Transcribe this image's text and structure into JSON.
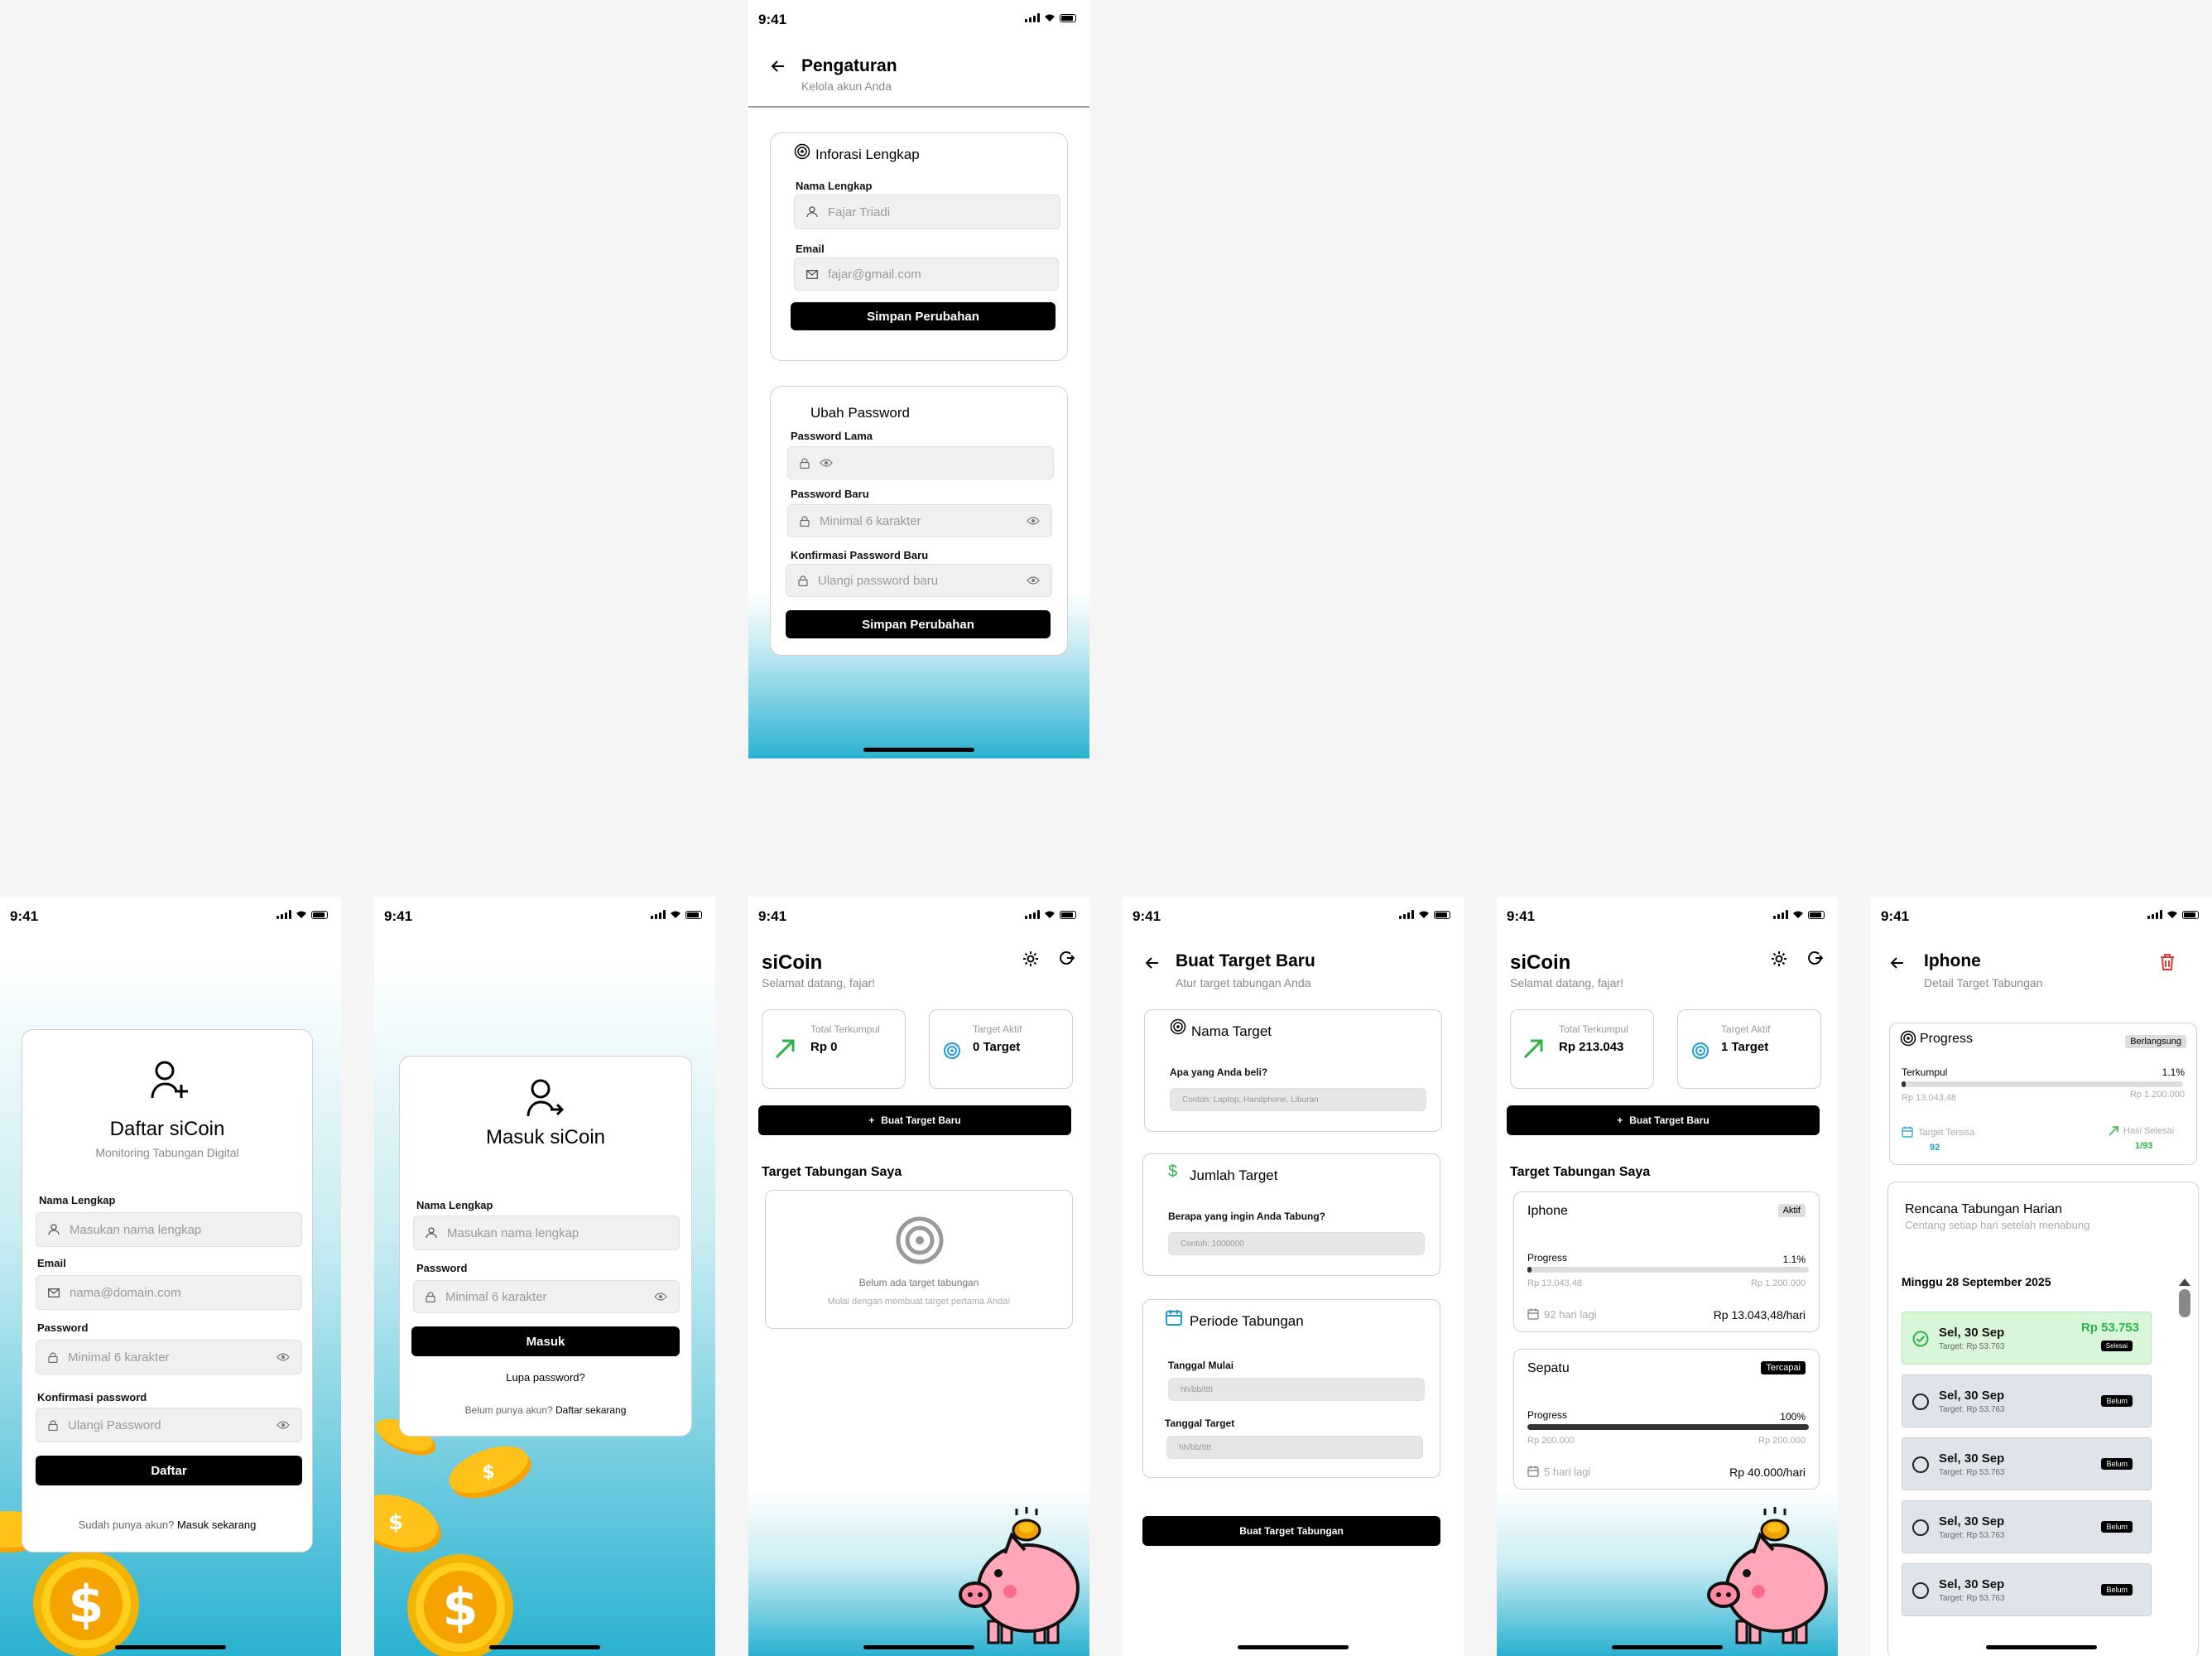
{
  "status_time": "9:41",
  "settings": {
    "title": "Pengaturan",
    "subtitle": "Kelola akun Anda",
    "info_title": "Inforasi Lengkap",
    "name_label": "Nama Lengkap",
    "name_value": "Fajar Triadi",
    "email_label": "Email",
    "email_value": "fajar@gmail.com",
    "save_label": "Simpan Perubahan",
    "pw_title": "Ubah Password",
    "old_pw_label": "Password Lama",
    "new_pw_label": "Password Baru",
    "new_pw_placeholder": "Minimal 6 karakter",
    "confirm_label": "Konfirmasi Password Baru",
    "confirm_placeholder": "Ulangi password baru",
    "save2_label": "Simpan Perubahan"
  },
  "register": {
    "title": "Daftar siCoin",
    "subtitle": "Monitoring Tabungan Digital",
    "name_label": "Nama Lengkap",
    "name_placeholder": "Masukan nama lengkap",
    "email_label": "Email",
    "email_placeholder": "nama@domain.com",
    "password_label": "Password",
    "password_placeholder": "Minimal 6 karakter",
    "confirm_label": "Konfirmasi password",
    "confirm_placeholder": "Ulangi Password",
    "submit_label": "Daftar",
    "footer_text": "Sudah punya akun?",
    "footer_link": "Masuk sekarang"
  },
  "login": {
    "title": "Masuk siCoin",
    "name_label": "Nama Lengkap",
    "name_placeholder": "Masukan nama lengkap",
    "password_label": "Password",
    "password_placeholder": "Minimal 6 karakter",
    "submit_label": "Masuk",
    "forgot_label": "Lupa password?",
    "footer_text": "Belum punya akun?",
    "footer_link": "Daftar sekarang"
  },
  "dashboard_empty": {
    "brand": "siCoin",
    "greeting": "Selamat datang, fajar!",
    "total_label": "Total Terkumpul",
    "total_value": "Rp 0",
    "active_label": "Target Aktif",
    "active_value": "0 Target",
    "new_target_label": "Buat Target Baru",
    "section_title": "Target Tabungan Saya",
    "empty_title": "Belum ada target tabungan",
    "empty_sub": "Mulai dengan membuat target pertama Anda!"
  },
  "new_target": {
    "title": "Buat Target Baru",
    "subtitle": "Atur target tabungan Anda",
    "name_title": "Nama Target",
    "name_question": "Apa yang Anda beli?",
    "name_placeholder": "Contoh: Laptop, Handphone, Liburan",
    "amount_title": "Jumlah Target",
    "amount_question": "Berapa yang ingin Anda Tabung?",
    "amount_placeholder": "Contoh: 1000000",
    "period_title": "Periode Tabungan",
    "start_label": "Tanggal Mulai",
    "start_placeholder": "hh/bb/tttt",
    "end_label": "Tanggal Target",
    "end_placeholder": "hh/bb/tttt",
    "submit_label": "Buat Target Tabungan"
  },
  "dashboard": {
    "brand": "siCoin",
    "greeting": "Selamat datang, fajar!",
    "total_label": "Total Terkumpul",
    "total_value": "Rp 213.043",
    "active_label": "Target Aktif",
    "active_value": "1 Target",
    "new_target_label": "Buat Target Baru",
    "section_title": "Target Tabungan Saya",
    "targets": [
      {
        "name": "Iphone",
        "status": "Aktif",
        "progress_label": "Progress",
        "percent": "1.1%",
        "progress": 0.011,
        "collected": "Rp 13.043,48",
        "goal": "Rp 1.200.000",
        "days": "92 hari lagi",
        "daily": "Rp 13.043,48/hari"
      },
      {
        "name": "Sepatu",
        "status": "Tercapai",
        "progress_label": "Progress",
        "percent": "100%",
        "progress": 1.0,
        "collected": "Rp 200.000",
        "goal": "Rp 200.000",
        "days": "5 hari lagi",
        "daily": "Rp 40.000/hari"
      }
    ]
  },
  "detail": {
    "title": "Iphone",
    "subtitle": "Detail Target Tabungan",
    "progress_title": "Progress",
    "status": "Berlangsung",
    "collected_label": "Terkumpul",
    "percent": "1.1%",
    "progress": 0.011,
    "collected_value": "Rp 13.043,48",
    "goal_value": "Rp 1.200.000",
    "remaining_label": "Target Tersisa",
    "remaining_value": "92",
    "done_label": "Hasi Selesai",
    "done_value": "1/93",
    "plan_title": "Rencana Tabungan Harian",
    "plan_sub": "Centang setiap hari setelah menabung",
    "week_label": "Minggu 28 September 2025",
    "days": [
      {
        "date": "Sel, 30 Sep",
        "target": "Target: Rp 53.763",
        "tag": "Selesai",
        "amount": "Rp 53.753",
        "done": true
      },
      {
        "date": "Sel, 30 Sep",
        "target": "Target: Rp 53.763",
        "tag": "Belum",
        "done": false
      },
      {
        "date": "Sel, 30 Sep",
        "target": "Target: Rp 53.763",
        "tag": "Belum",
        "done": false
      },
      {
        "date": "Sel, 30 Sep",
        "target": "Target: Rp 53.763",
        "tag": "Belum",
        "done": false
      },
      {
        "date": "Sel, 30 Sep",
        "target": "Target: Rp 53.763",
        "tag": "Belum",
        "done": false
      }
    ]
  },
  "colors": {
    "accent_green": "#2bb34a",
    "accent_blue": "#1c9bd4",
    "danger_red": "#e53935",
    "gradient_cyan": "#2ab1d0"
  }
}
